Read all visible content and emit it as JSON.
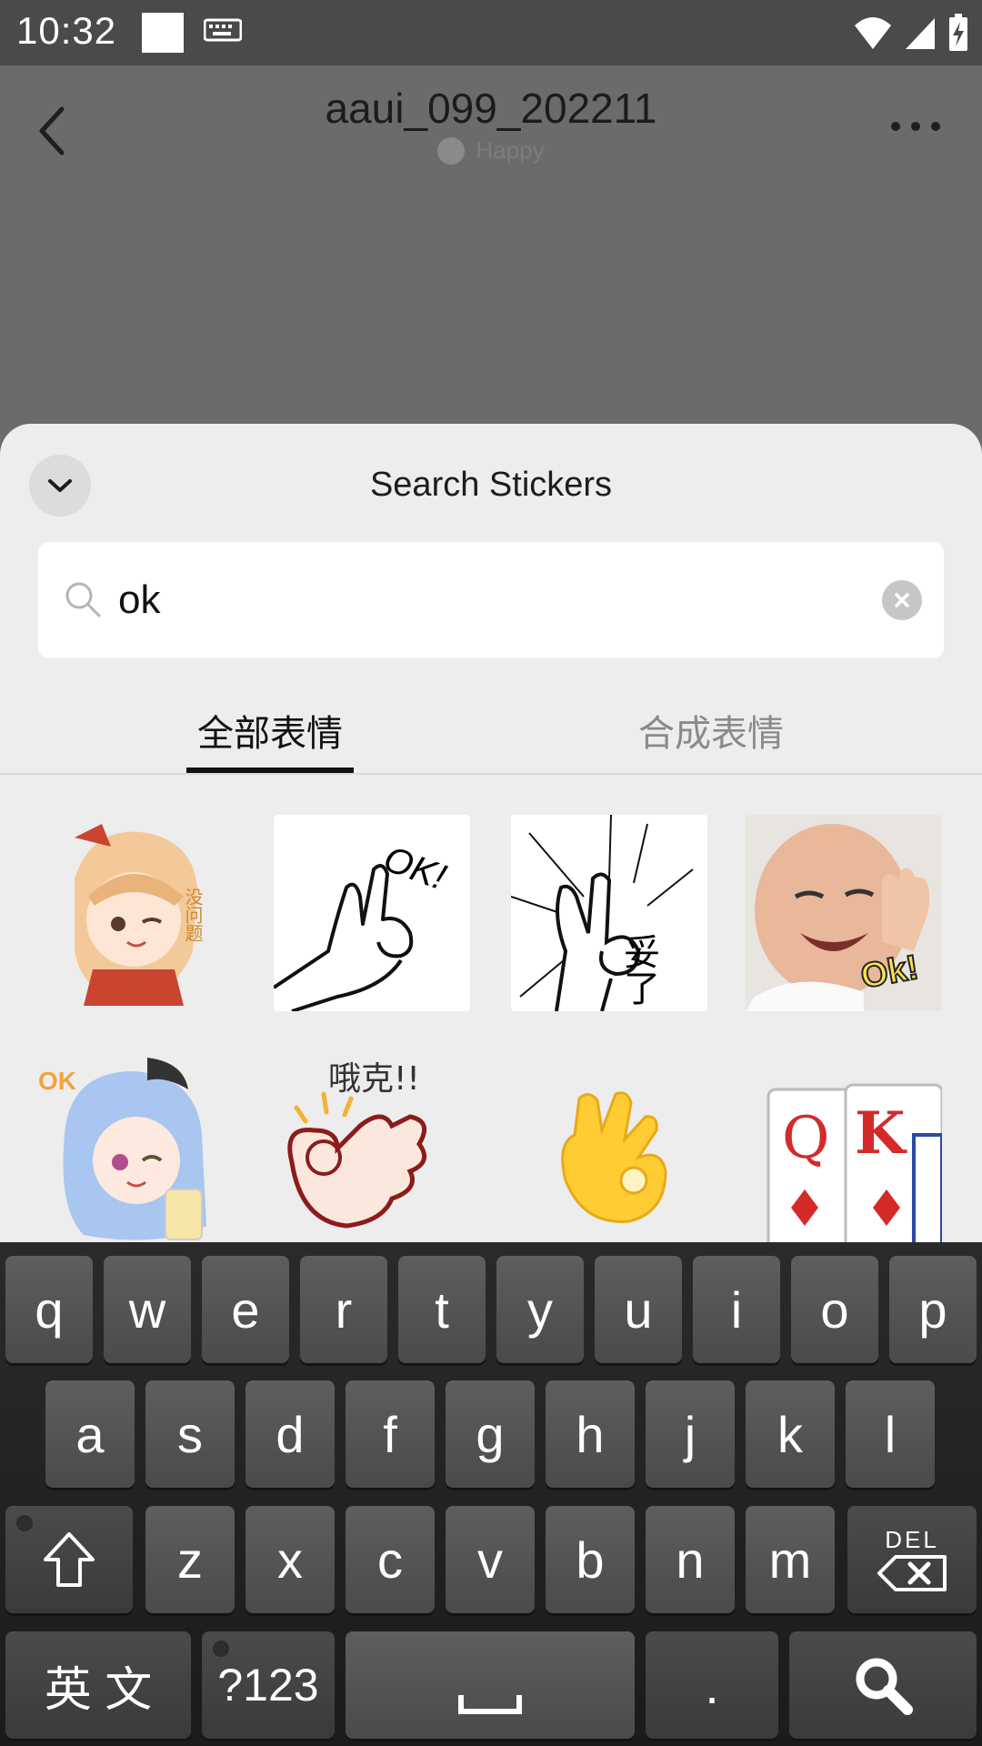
{
  "status_bar": {
    "time": "10:32"
  },
  "header": {
    "title": "aaui_099_202211",
    "status": "Happy"
  },
  "sticker_panel": {
    "title": "Search Stickers",
    "search": {
      "value": "ok"
    },
    "tabs": [
      {
        "label": "全部表情",
        "selected": true
      },
      {
        "label": "合成表情",
        "selected": false
      }
    ],
    "stickers": [
      {
        "name": "anime-girl-sticker",
        "caption": "没问题"
      },
      {
        "name": "ok-hand-drawing-sticker",
        "caption": "OK!"
      },
      {
        "name": "ok-hand-manga-sticker",
        "caption": "妥了"
      },
      {
        "name": "baby-ok-sticker",
        "caption": "Ok!"
      },
      {
        "name": "anime-ok-sticker",
        "caption": "OK"
      },
      {
        "name": "ok-hand-cartoon-sticker",
        "caption": "哦克!!"
      },
      {
        "name": "ok-hand-emoji-sticker",
        "caption": ""
      },
      {
        "name": "playing-cards-sticker",
        "caption": ""
      }
    ]
  },
  "keyboard": {
    "row1": [
      "q",
      "w",
      "e",
      "r",
      "t",
      "y",
      "u",
      "i",
      "o",
      "p"
    ],
    "row2": [
      "a",
      "s",
      "d",
      "f",
      "g",
      "h",
      "j",
      "k",
      "l"
    ],
    "row3": [
      "z",
      "x",
      "c",
      "v",
      "b",
      "n",
      "m"
    ],
    "lang_key": "英 文",
    "symbols_key": "?123",
    "period_key": ".",
    "del_label": "DEL"
  },
  "colors": {
    "panel_bg": "#ededed",
    "status_bar_bg": "#4a4a4a",
    "keyboard_bg": "#222222"
  }
}
